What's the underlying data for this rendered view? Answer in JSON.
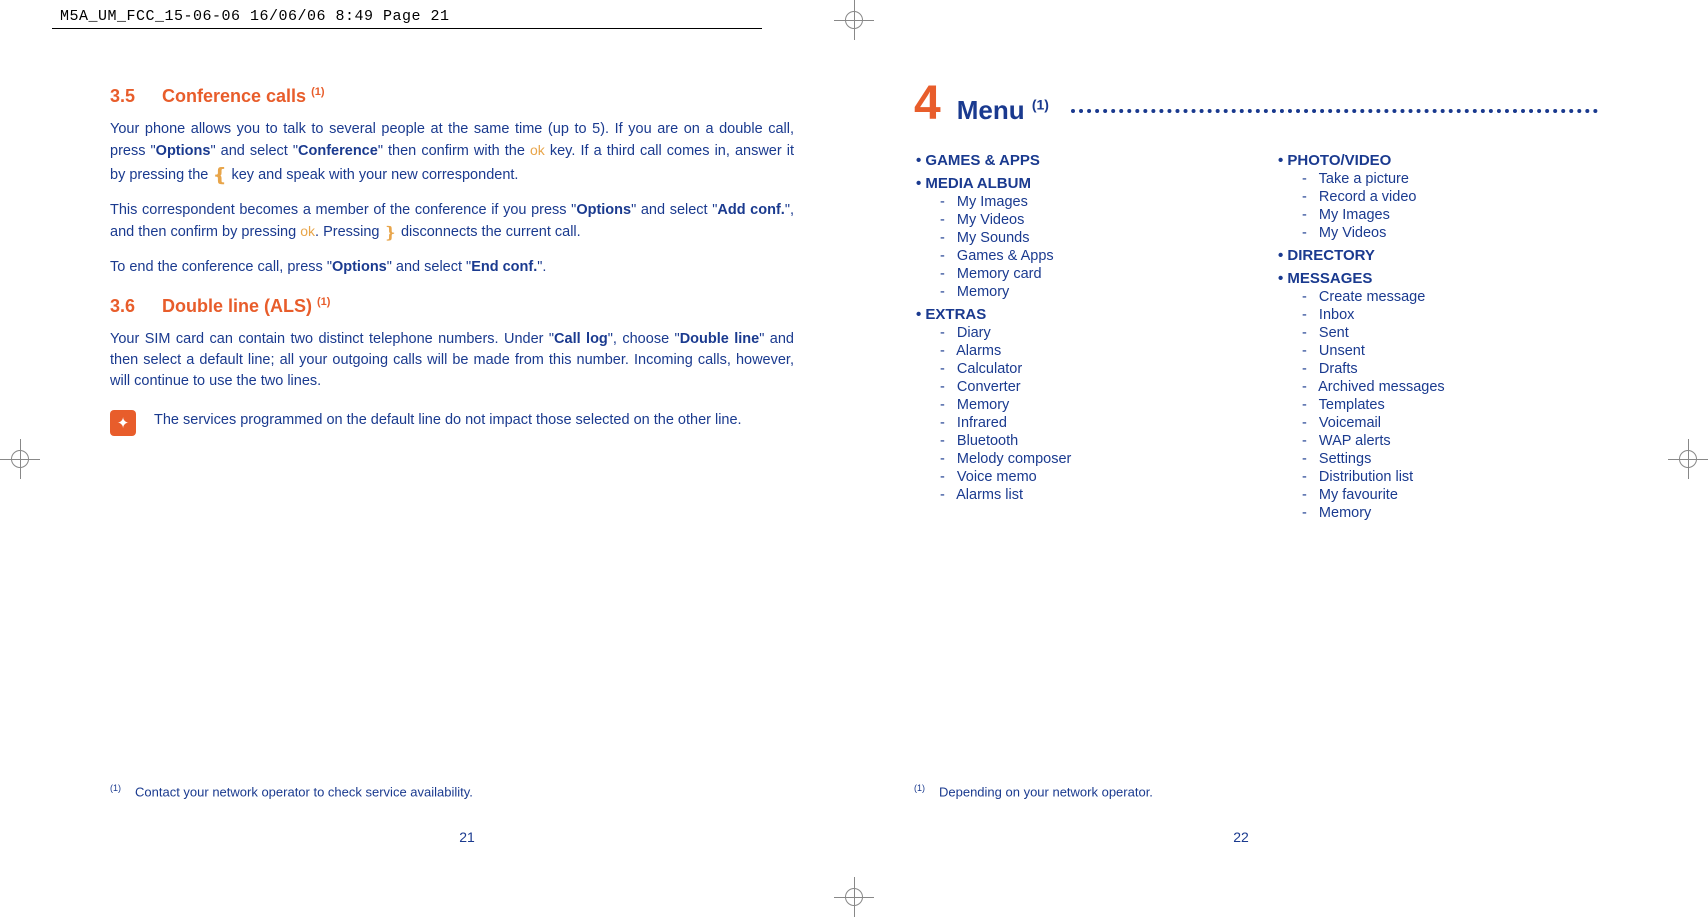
{
  "header": "M5A_UM_FCC_15-06-06  16/06/06  8:49  Page 21",
  "left": {
    "sec1_num": "3.5",
    "sec1_title": "Conference calls ",
    "sec1_sup": "(1)",
    "p1a": "Your phone allows you to talk to several people at the same time (up to 5). If you are on a double call, press \"",
    "p1b": "Options",
    "p1c": "\" and select \"",
    "p1d": "Conference",
    "p1e": "\" then confirm with the ",
    "p1f": " key. If a third call comes in, answer it by pressing the ",
    "p1g": " key and speak with your new correspondent.",
    "p2a": "This correspondent becomes a member of the conference if you press \"",
    "p2b": "Options",
    "p2c": "\" and select \"",
    "p2d": "Add conf.",
    "p2e": "\", and then confirm by pressing ",
    "p2f": ". Pressing ",
    "p2g": " disconnects the current call.",
    "p3a": "To end the conference call, press \"",
    "p3b": "Options",
    "p3c": "\" and select \"",
    "p3d": "End conf.",
    "p3e": "\".",
    "sec2_num": "3.6",
    "sec2_title": "Double line (ALS) ",
    "sec2_sup": "(1)",
    "p4a": "Your SIM card can contain two distinct telephone numbers. Under \"",
    "p4b": "Call log",
    "p4c": "\", choose \"",
    "p4d": "Double line",
    "p4e": "\" and then select a default line; all your outgoing calls will be made from this number. Incoming calls, however, will continue to use the two lines.",
    "note": "The services programmed on the default line do not impact those selected on the other line.",
    "footnote_sup": "(1)",
    "footnote": "Contact your network operator to check service availability.",
    "page_num": "21"
  },
  "right": {
    "chap_num": "4",
    "chap_title": "Menu ",
    "chap_sup": "(1)",
    "col1": [
      {
        "top": "GAMES & APPS",
        "subs": []
      },
      {
        "top": "MEDIA ALBUM",
        "subs": [
          "My Images",
          "My Videos",
          "My Sounds",
          "Games & Apps",
          "Memory card",
          "Memory"
        ]
      },
      {
        "top": "EXTRAS",
        "subs": [
          "Diary",
          "Alarms",
          "Calculator",
          "Converter",
          "Memory",
          "Infrared",
          "Bluetooth",
          "Melody composer",
          "Voice memo",
          "Alarms list"
        ]
      }
    ],
    "col2": [
      {
        "top": "PHOTO/VIDEO",
        "subs": [
          "Take a picture",
          "Record a video",
          "My Images",
          "My Videos"
        ]
      },
      {
        "top": "DIRECTORY",
        "subs": []
      },
      {
        "top": "MESSAGES",
        "subs": [
          "Create message",
          "Inbox",
          "Sent",
          "Unsent",
          "Drafts",
          "Archived messages",
          "Templates",
          "Voicemail",
          "WAP alerts",
          "Settings",
          "Distribution list",
          "My favourite",
          "Memory"
        ]
      }
    ],
    "footnote_sup": "(1)",
    "footnote": "Depending on your network operator.",
    "page_num": "22"
  },
  "ok_glyph": "ok",
  "call_glyph": "❴",
  "end_glyph": "❵"
}
